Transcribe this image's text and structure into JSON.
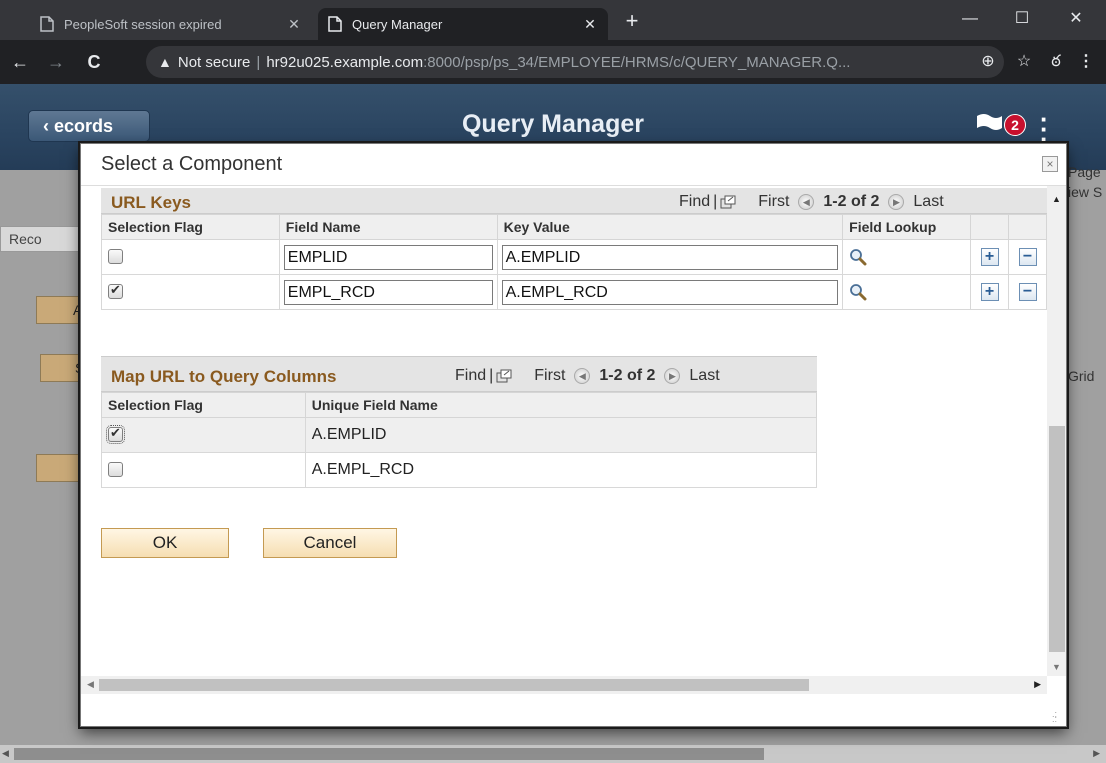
{
  "browser": {
    "tabs": [
      {
        "title": "PeopleSoft session expired",
        "active": false
      },
      {
        "title": "Query Manager",
        "active": true
      }
    ],
    "new_tab": "+",
    "controls": {
      "minimize": "—",
      "maximize": "☐",
      "close": "✕"
    },
    "nav": {
      "back": "←",
      "forward": "→",
      "reload": "C"
    },
    "address": {
      "warning_icon": "▲",
      "not_secure": "Not secure",
      "separator": "|",
      "host": "hr92u025.example.com",
      "path": ":8000/psp/ps_34/EMPLOYEE/HRMS/c/QUERY_MANAGER.Q..."
    },
    "icons": {
      "zoom": "⊕",
      "star": "☆",
      "extension": "ఠ",
      "menu": "⋮"
    }
  },
  "app": {
    "back_label": "ecords",
    "title": "Query Manager",
    "notification_count": "2",
    "bg": {
      "tab_label": "Reco",
      "btn1_letter": "A",
      "btn2_letter": "S",
      "right_page": "Page",
      "right_view": "iew S",
      "right_grid": "Grid"
    }
  },
  "dialog": {
    "title": "Select a Component",
    "close_glyph": "×",
    "url_keys": {
      "title": "URL Keys",
      "find": "Find",
      "sep": "|",
      "first": "First",
      "range": "1-2 of 2",
      "last": "Last",
      "columns": [
        "Selection Flag",
        "Field Name",
        "Key Value",
        "Field Lookup"
      ],
      "rows": [
        {
          "checked": false,
          "field_name": "EMPLID",
          "key_value": "A.EMPLID"
        },
        {
          "checked": true,
          "field_name": "EMPL_RCD",
          "key_value": "A.EMPL_RCD"
        }
      ],
      "add_glyph": "+",
      "remove_glyph": "−"
    },
    "map_url": {
      "title": "Map URL to Query Columns",
      "find": "Find",
      "sep": "|",
      "first": "First",
      "range": "1-2 of 2",
      "last": "Last",
      "columns": [
        "Selection Flag",
        "Unique Field Name"
      ],
      "rows": [
        {
          "checked": true,
          "unique_field_name": "A.EMPLID"
        },
        {
          "checked": false,
          "unique_field_name": "A.EMPL_RCD"
        }
      ]
    },
    "ok_label": "OK",
    "cancel_label": "Cancel"
  },
  "colors": {
    "group_title": "#8a5a1f",
    "header_bg": "#2a4460",
    "button_border": "#c49a52",
    "badge": "#c8102e"
  }
}
